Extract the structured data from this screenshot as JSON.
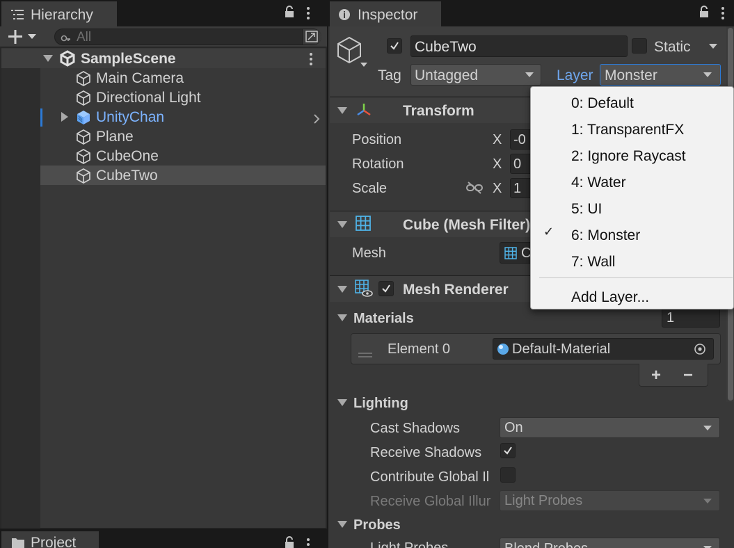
{
  "hierarchy": {
    "tab_label": "Hierarchy",
    "search_placeholder": "All",
    "scene_name": "SampleScene",
    "items": [
      {
        "label": "Main Camera"
      },
      {
        "label": "Directional Light"
      },
      {
        "label": "UnityChan"
      },
      {
        "label": "Plane"
      },
      {
        "label": "CubeOne"
      },
      {
        "label": "CubeTwo"
      }
    ]
  },
  "project": {
    "tab_label": "Project"
  },
  "inspector": {
    "tab_label": "Inspector",
    "object_name": "CubeTwo",
    "static_label": "Static",
    "tag_label": "Tag",
    "tag_value": "Untagged",
    "layer_label": "Layer",
    "layer_value": "Monster",
    "transform": {
      "title": "Transform",
      "position_label": "Position",
      "rotation_label": "Rotation",
      "scale_label": "Scale",
      "x_label": "X",
      "position_x": "-0",
      "rotation_x": "0",
      "scale_x": "1"
    },
    "mesh_filter": {
      "title": "Cube (Mesh Filter)",
      "mesh_label": "Mesh",
      "mesh_value": "C"
    },
    "mesh_renderer": {
      "title": "Mesh Renderer",
      "materials_label": "Materials",
      "materials_count": "1",
      "element_label": "Element 0",
      "element_value": "Default-Material",
      "add_symbol": "+",
      "remove_symbol": "−",
      "lighting_label": "Lighting",
      "cast_shadows_label": "Cast Shadows",
      "cast_shadows_value": "On",
      "receive_shadows_label": "Receive Shadows",
      "contribute_gi_label": "Contribute Global Il",
      "receive_gi_label": "Receive Global Illur",
      "receive_gi_value": "Light Probes",
      "probes_label": "Probes",
      "light_probes_label": "Light Probes",
      "light_probes_value": "Blend Probes"
    }
  },
  "layer_menu": {
    "items": [
      {
        "label": "0: Default",
        "checked": false
      },
      {
        "label": "1: TransparentFX",
        "checked": false
      },
      {
        "label": "2: Ignore Raycast",
        "checked": false
      },
      {
        "label": "4: Water",
        "checked": false
      },
      {
        "label": "5: UI",
        "checked": false
      },
      {
        "label": "6: Monster",
        "checked": true
      },
      {
        "label": "7: Wall",
        "checked": false
      }
    ],
    "add_layer_label": "Add Layer...",
    "check_glyph": "✓"
  },
  "colors": {
    "prefab_blue": "#7cb3ff",
    "layer_label_blue": "#6fa7ee",
    "selection_blue": "#2c7ad6"
  }
}
